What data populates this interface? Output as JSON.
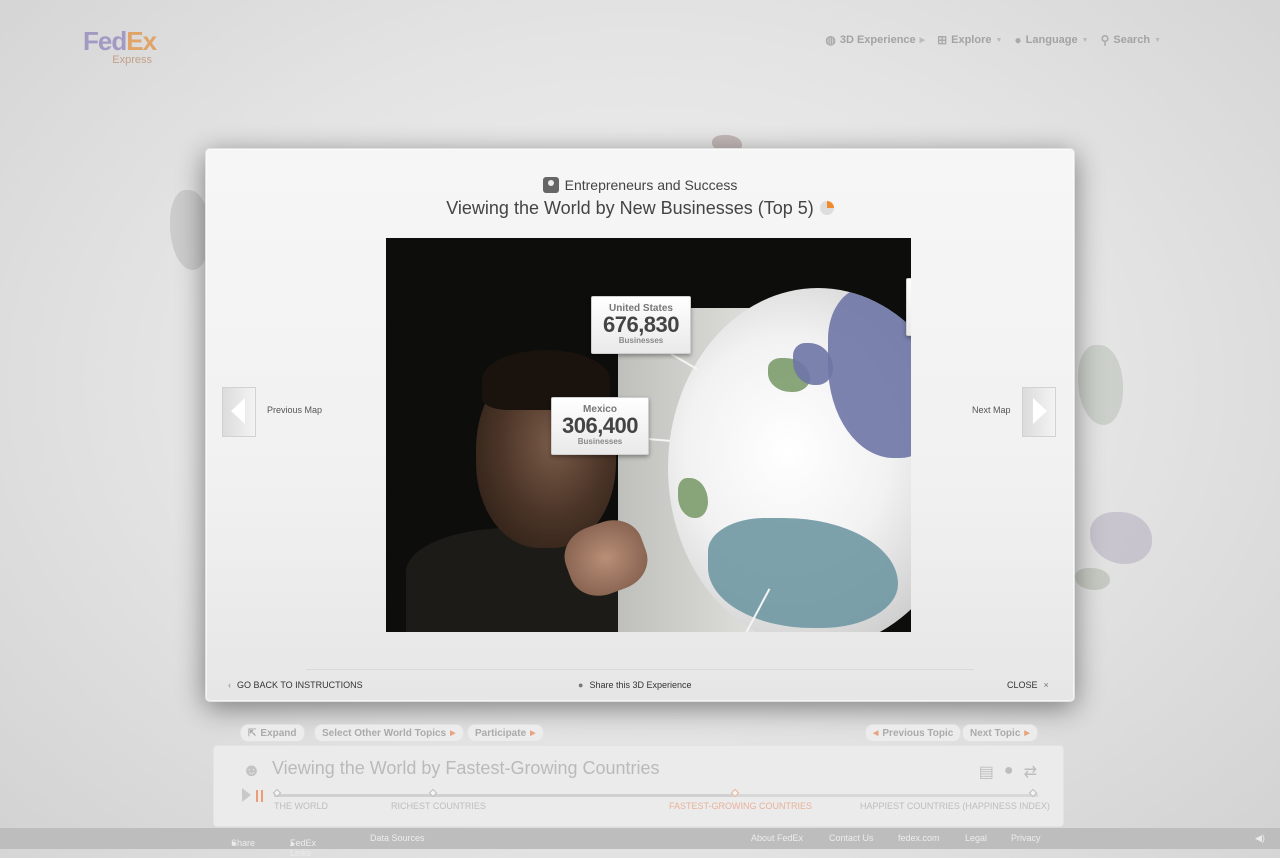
{
  "header": {
    "logo": {
      "fed": "Fed",
      "ex": "Ex",
      "sub": "Express"
    },
    "nav": [
      {
        "label": "3D Experience",
        "icon": "globe-icon"
      },
      {
        "label": "Explore",
        "icon": "sitemap-icon"
      },
      {
        "label": "Language",
        "icon": "speech-bubble-icon"
      },
      {
        "label": "Search",
        "icon": "search-icon"
      }
    ]
  },
  "modal": {
    "category": "Entrepreneurs and Success",
    "title": "Viewing the World by New Businesses (Top 5)",
    "callouts": [
      {
        "country": "United States",
        "value": "676,830",
        "unit": "Businesses"
      },
      {
        "country": "Mexico",
        "value": "306,400",
        "unit": "Businesses"
      }
    ],
    "prev_label": "Previous Map",
    "next_label": "Next Map",
    "footer": {
      "back": "GO BACK TO INSTRUCTIONS",
      "share": "Share this 3D Experience",
      "close": "CLOSE"
    }
  },
  "topicbar": {
    "expand": "Expand",
    "select_topics": "Select Other World Topics",
    "participate": "Participate",
    "prev_topic": "Previous Topic",
    "next_topic": "Next Topic",
    "title": "Viewing the World by Fastest-Growing Countries",
    "timeline": [
      "THE WORLD",
      "RICHEST COUNTRIES",
      "FASTEST-GROWING COUNTRIES",
      "HAPPIEST COUNTRIES (HAPPINESS INDEX)"
    ],
    "active_index": 2
  },
  "footer": {
    "share": "Share",
    "fedex_links": "FedEx Links",
    "data_sources": "Data Sources",
    "about": "About FedEx",
    "contact": "Contact Us",
    "site": "fedex.com",
    "legal": "Legal",
    "privacy": "Privacy"
  },
  "colors": {
    "accent": "#e8a27d",
    "brand_purple": "#a39ac4",
    "brand_orange": "#e0a368"
  }
}
